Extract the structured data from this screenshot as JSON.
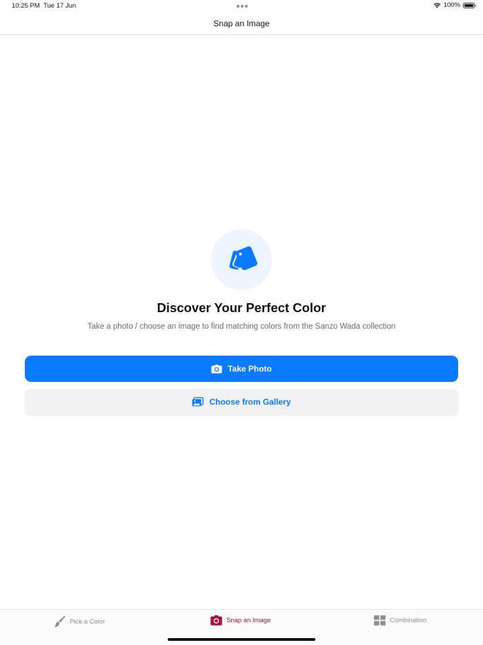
{
  "status_bar": {
    "time": "10:25 PM",
    "date": "Tue 17 Jun",
    "battery": "100%",
    "battery_level": 1.0
  },
  "nav": {
    "title": "Snap an Image"
  },
  "hero": {
    "icon": "color-swatch-cards-icon",
    "title": "Discover Your Perfect Color",
    "subtitle": "Take a photo / choose an image to find matching colors from the Sanzo Wada collection"
  },
  "actions": {
    "take_photo": {
      "label": "Take Photo",
      "icon": "camera-icon"
    },
    "gallery": {
      "label": "Choose from Gallery",
      "icon": "photos-icon"
    }
  },
  "tabs": [
    {
      "label": "Pick a Color",
      "icon": "paintbrush-icon",
      "active": false
    },
    {
      "label": "Snap an Image",
      "icon": "camera-icon",
      "active": true
    },
    {
      "label": "Combination",
      "icon": "grid-icon",
      "active": false
    }
  ],
  "colors": {
    "accent": "#0a7aff",
    "active_tab": "#a8123e",
    "inactive_tab": "#8e8e93",
    "hero_bg": "#eef5ff",
    "secondary_button_bg": "#f2f2f4"
  }
}
